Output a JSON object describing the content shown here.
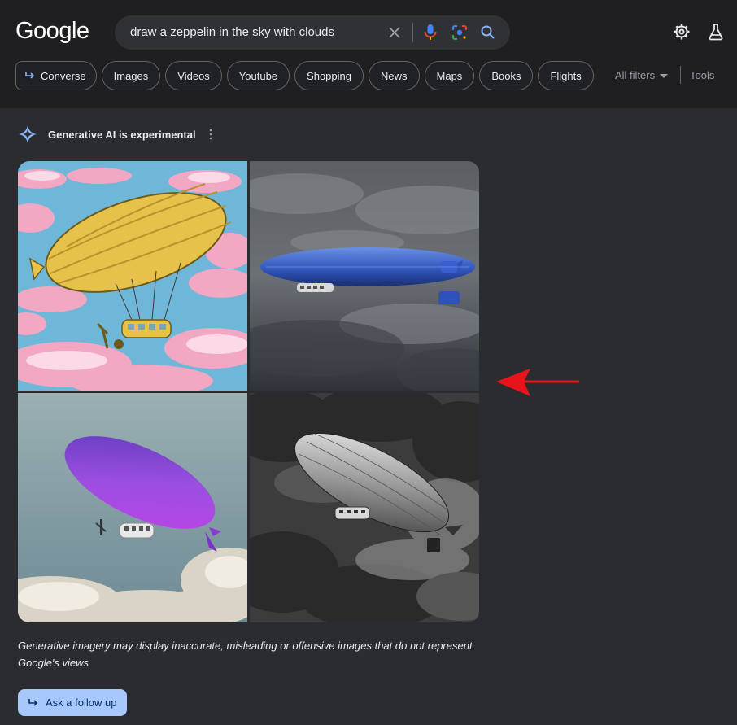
{
  "header": {
    "logo": "Google",
    "search_query": "draw a zeppelin in the sky with clouds",
    "icons": [
      "clear-icon",
      "mic-icon",
      "lens-icon",
      "search-icon",
      "settings-icon",
      "labs-icon"
    ]
  },
  "chips": [
    {
      "label": "Converse",
      "icon": "follow-up-arrow-icon"
    },
    {
      "label": "Images"
    },
    {
      "label": "Videos"
    },
    {
      "label": "Youtube"
    },
    {
      "label": "Shopping"
    },
    {
      "label": "News"
    },
    {
      "label": "Maps"
    },
    {
      "label": "Books"
    },
    {
      "label": "Flights"
    }
  ],
  "filters": {
    "all_filters": "All filters",
    "tools": "Tools"
  },
  "ai": {
    "title": "Generative AI is experimental",
    "images": [
      {
        "subject": "yellow zeppelin with pink clouds"
      },
      {
        "subject": "blue zeppelin in stormy sky"
      },
      {
        "subject": "purple zeppelin above clouds"
      },
      {
        "subject": "silver zeppelin in dark clouds"
      }
    ],
    "disclaimer": "Generative imagery may display inaccurate, misleading or offensive images that do not represent Google's views",
    "follow_up_label": "Ask a follow up"
  },
  "colors": {
    "background": "#202124",
    "panel": "#2b2c30",
    "accent_button": "#a8c7fa",
    "annotation_arrow": "#e8141b"
  }
}
